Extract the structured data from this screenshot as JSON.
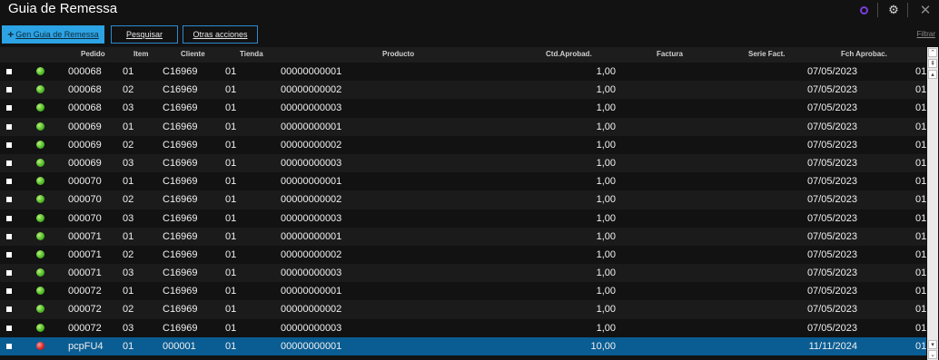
{
  "window": {
    "title": "Guia de Remessa",
    "icons": [
      "symbol-icon",
      "gear-icon",
      "close-icon"
    ]
  },
  "toolbar": {
    "gen_label": "Gen Guia de Remessa",
    "search_label": "Pesquisar",
    "more_label": "Otras acciones",
    "filter_label": "Filtrar"
  },
  "table": {
    "columns": {
      "pedido": "Pedido",
      "item": "Item",
      "cliente": "Cliente",
      "tienda": "Tienda",
      "producto": "Producto",
      "ctd": "Ctd.Aprobad.",
      "factura": "Factura",
      "serie": "Serie Fact.",
      "fch": "Fch Aprobac."
    },
    "rows": [
      {
        "status": "green",
        "pedido": "000068",
        "item": "01",
        "cliente": "C16969",
        "tienda": "01",
        "producto": "00000000001",
        "ctd": "1,00",
        "factura": "",
        "serie": "",
        "fch": "07/05/2023",
        "last": "01"
      },
      {
        "status": "green",
        "pedido": "000068",
        "item": "02",
        "cliente": "C16969",
        "tienda": "01",
        "producto": "00000000002",
        "ctd": "1,00",
        "factura": "",
        "serie": "",
        "fch": "07/05/2023",
        "last": "01"
      },
      {
        "status": "green",
        "pedido": "000068",
        "item": "03",
        "cliente": "C16969",
        "tienda": "01",
        "producto": "00000000003",
        "ctd": "1,00",
        "factura": "",
        "serie": "",
        "fch": "07/05/2023",
        "last": "01"
      },
      {
        "status": "green",
        "pedido": "000069",
        "item": "01",
        "cliente": "C16969",
        "tienda": "01",
        "producto": "00000000001",
        "ctd": "1,00",
        "factura": "",
        "serie": "",
        "fch": "07/05/2023",
        "last": "01"
      },
      {
        "status": "green",
        "pedido": "000069",
        "item": "02",
        "cliente": "C16969",
        "tienda": "01",
        "producto": "00000000002",
        "ctd": "1,00",
        "factura": "",
        "serie": "",
        "fch": "07/05/2023",
        "last": "01"
      },
      {
        "status": "green",
        "pedido": "000069",
        "item": "03",
        "cliente": "C16969",
        "tienda": "01",
        "producto": "00000000003",
        "ctd": "1,00",
        "factura": "",
        "serie": "",
        "fch": "07/05/2023",
        "last": "01"
      },
      {
        "status": "green",
        "pedido": "000070",
        "item": "01",
        "cliente": "C16969",
        "tienda": "01",
        "producto": "00000000001",
        "ctd": "1,00",
        "factura": "",
        "serie": "",
        "fch": "07/05/2023",
        "last": "01"
      },
      {
        "status": "green",
        "pedido": "000070",
        "item": "02",
        "cliente": "C16969",
        "tienda": "01",
        "producto": "00000000002",
        "ctd": "1,00",
        "factura": "",
        "serie": "",
        "fch": "07/05/2023",
        "last": "01"
      },
      {
        "status": "green",
        "pedido": "000070",
        "item": "03",
        "cliente": "C16969",
        "tienda": "01",
        "producto": "00000000003",
        "ctd": "1,00",
        "factura": "",
        "serie": "",
        "fch": "07/05/2023",
        "last": "01"
      },
      {
        "status": "green",
        "pedido": "000071",
        "item": "01",
        "cliente": "C16969",
        "tienda": "01",
        "producto": "00000000001",
        "ctd": "1,00",
        "factura": "",
        "serie": "",
        "fch": "07/05/2023",
        "last": "01"
      },
      {
        "status": "green",
        "pedido": "000071",
        "item": "02",
        "cliente": "C16969",
        "tienda": "01",
        "producto": "00000000002",
        "ctd": "1,00",
        "factura": "",
        "serie": "",
        "fch": "07/05/2023",
        "last": "01"
      },
      {
        "status": "green",
        "pedido": "000071",
        "item": "03",
        "cliente": "C16969",
        "tienda": "01",
        "producto": "00000000003",
        "ctd": "1,00",
        "factura": "",
        "serie": "",
        "fch": "07/05/2023",
        "last": "01"
      },
      {
        "status": "green",
        "pedido": "000072",
        "item": "01",
        "cliente": "C16969",
        "tienda": "01",
        "producto": "00000000001",
        "ctd": "1,00",
        "factura": "",
        "serie": "",
        "fch": "07/05/2023",
        "last": "01"
      },
      {
        "status": "green",
        "pedido": "000072",
        "item": "02",
        "cliente": "C16969",
        "tienda": "01",
        "producto": "00000000002",
        "ctd": "1,00",
        "factura": "",
        "serie": "",
        "fch": "07/05/2023",
        "last": "01"
      },
      {
        "status": "green",
        "pedido": "000072",
        "item": "03",
        "cliente": "C16969",
        "tienda": "01",
        "producto": "00000000003",
        "ctd": "1,00",
        "factura": "",
        "serie": "",
        "fch": "07/05/2023",
        "last": "01"
      },
      {
        "status": "red",
        "pedido": "pcpFU4",
        "item": "01",
        "cliente": "000001",
        "tienda": "01",
        "producto": "00000000001",
        "ctd": "10,00",
        "factura": "",
        "serie": "",
        "fch": "11/11/2024",
        "last": "01",
        "selected": true
      }
    ]
  },
  "colors": {
    "background": "#121212",
    "row_alt": "#1b1b1b",
    "selected_row": "#0a5d93",
    "primary_button": "#2ca3e4",
    "button_border": "#2c8ad0",
    "status_green": "#4cb824",
    "status_red": "#d82020"
  }
}
